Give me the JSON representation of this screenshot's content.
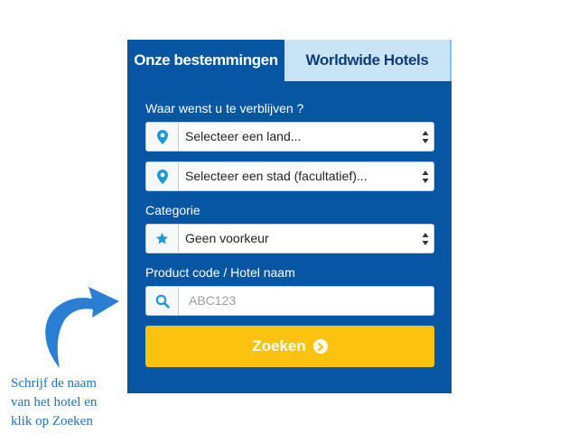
{
  "tabs": [
    {
      "label": "Onze bestemmingen",
      "active": true
    },
    {
      "label": "Worldwide Hotels",
      "active": false
    }
  ],
  "form": {
    "stay_label": "Waar wenst u te verblijven ?",
    "country_select": {
      "value": "Selecteer een land...",
      "icon": "map-pin-icon"
    },
    "city_select": {
      "value": "Selecteer een stad (facultatief)...",
      "icon": "map-pin-icon"
    },
    "category_label": "Categorie",
    "category_select": {
      "value": "Geen voorkeur",
      "icon": "star-icon"
    },
    "product_label": "Product code / Hotel naam",
    "search_input": {
      "placeholder": "ABC123",
      "value": "",
      "icon": "search-icon"
    },
    "submit_label": "Zoeken"
  },
  "annotation": {
    "lines": [
      "Schrijf de naam",
      "van het hotel en",
      "klik op Zoeken"
    ]
  },
  "colors": {
    "panel": "#0656a3",
    "inactive_tab": "#c8e4f5",
    "button": "#fbc20f",
    "icon": "#1a9ad6",
    "annotation": "#1c72c9"
  }
}
